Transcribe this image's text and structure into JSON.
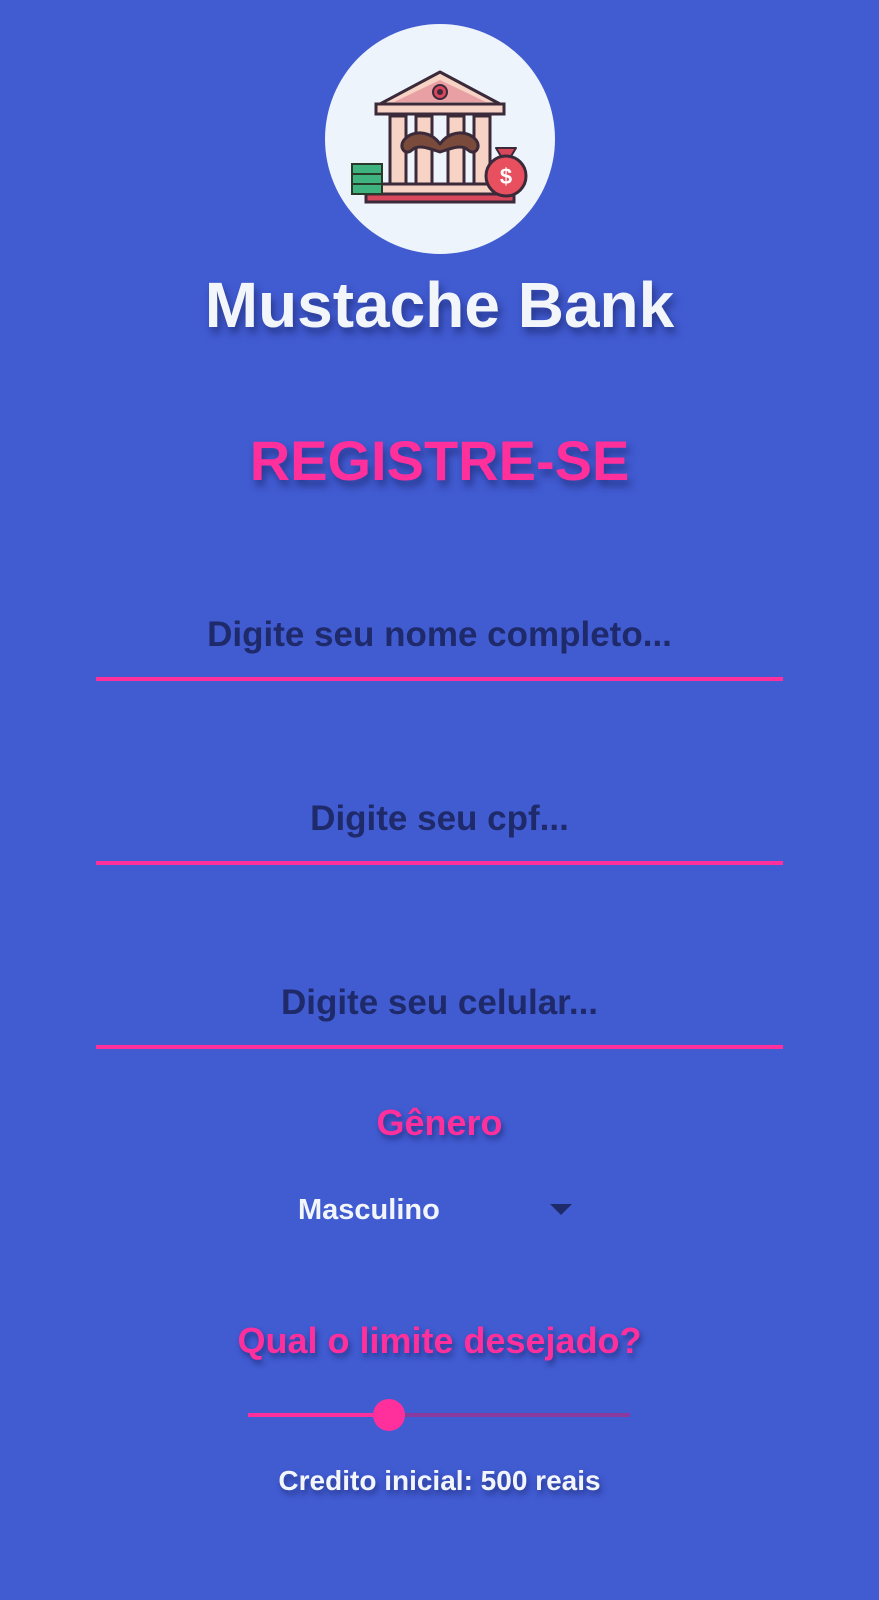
{
  "app": {
    "name": "Mustache Bank",
    "logo_icon": "mustache-bank-logo-icon"
  },
  "register": {
    "title": "REGISTRE-SE",
    "name_placeholder": "Digite seu nome completo...",
    "cpf_placeholder": "Digite seu cpf...",
    "phone_placeholder": "Digite seu celular...",
    "gender_label": "Gênero",
    "gender_selected": "Masculino",
    "limit_label": "Qual o limite desejado?",
    "limit_slider_fraction": 0.37,
    "credit_text": "Credito inicial: 500 reais"
  },
  "colors": {
    "background": "#415bd1",
    "accent": "#ff2f9b",
    "text_light": "#f2f6fb",
    "text_dark": "#1e2a6a"
  }
}
